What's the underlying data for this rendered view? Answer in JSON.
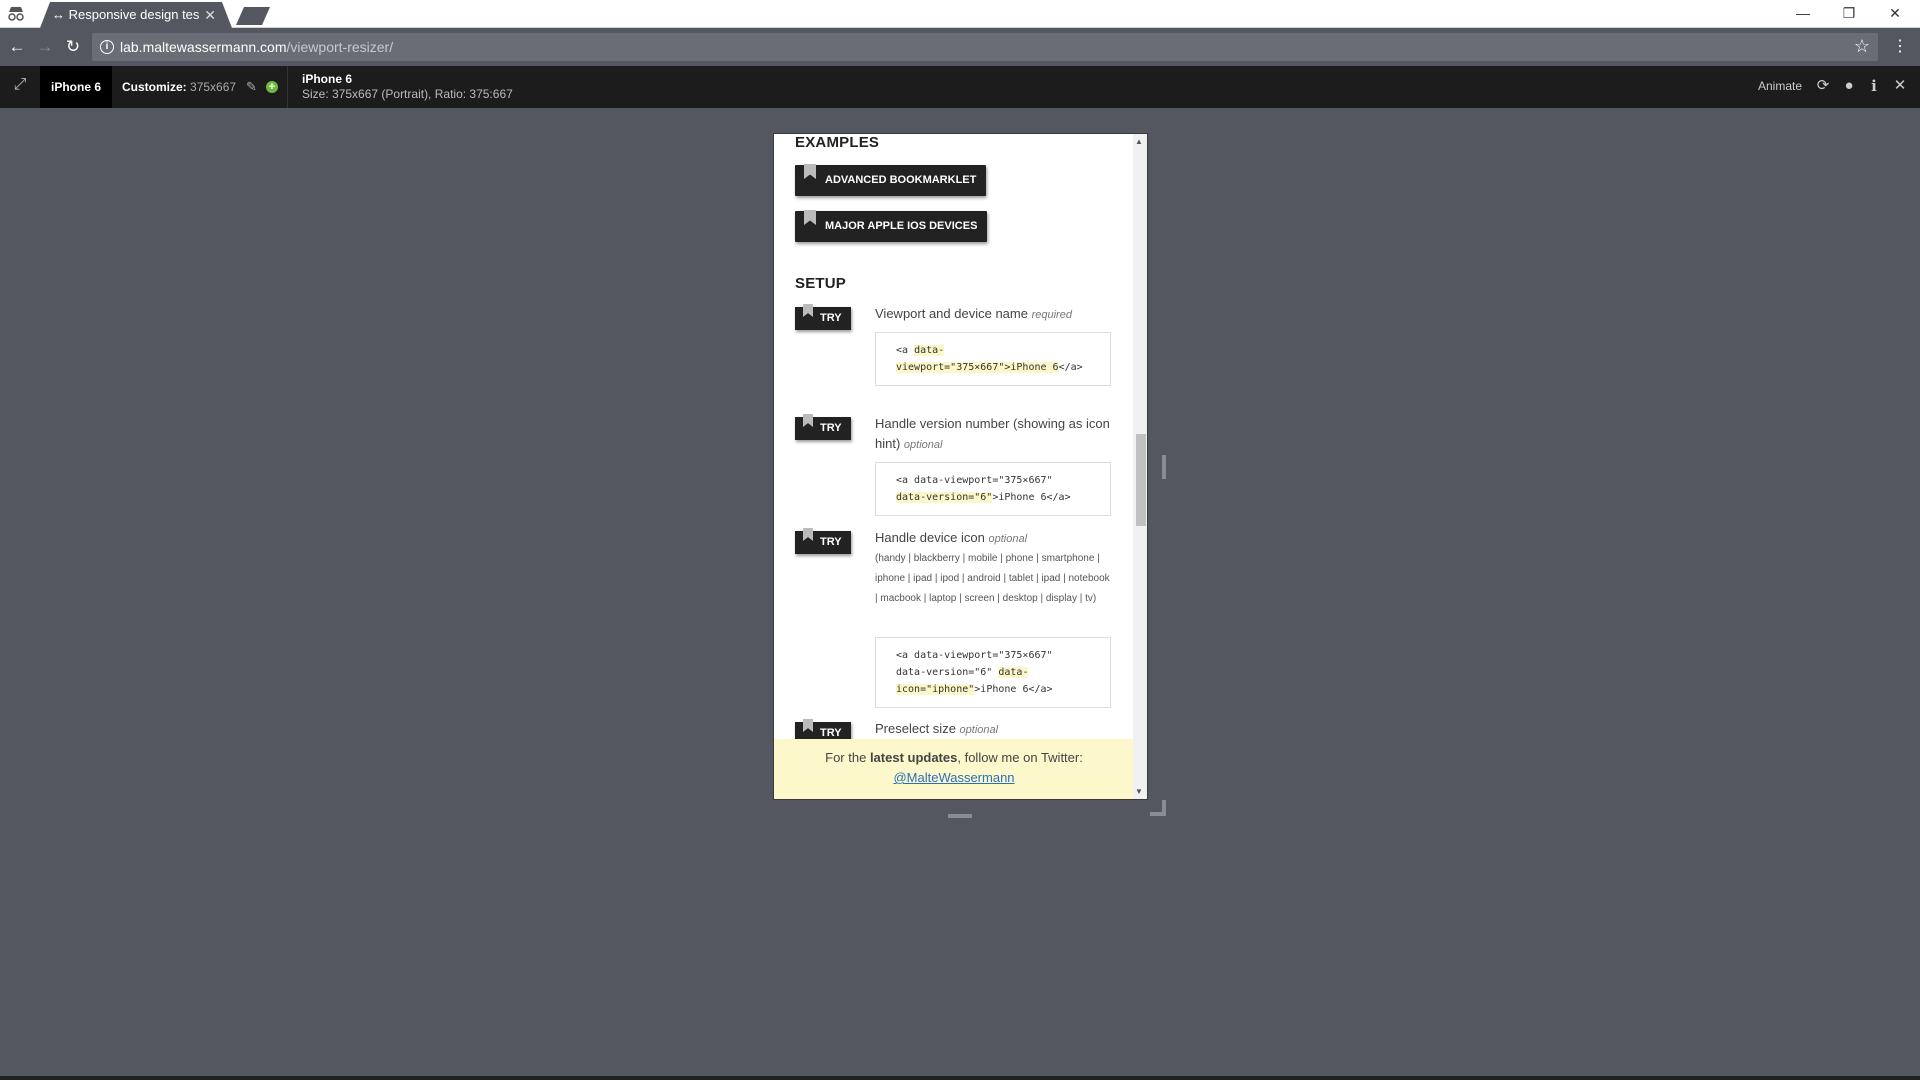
{
  "browser": {
    "tab_title": "↔ Responsive design tes",
    "url_host": "lab.maltewassermann.com",
    "url_path": "/viewport-resizer/"
  },
  "resizer": {
    "device_label": "iPhone 6",
    "customize_label": "Customize:",
    "customize_value": "375x667",
    "info_name": "iPhone 6",
    "info_size": "Size: 375x667 (Portrait), Ratio: 375:667",
    "animate_label": "Animate"
  },
  "page": {
    "examples_heading": "EXAMPLES",
    "example_buttons": [
      "ADVANCED BOOKMARKLET",
      "MAJOR APPLE IOS DEVICES"
    ],
    "setup_heading": "SETUP",
    "try_label": "TRY",
    "rows": [
      {
        "title": "Viewport and device name",
        "note": "required",
        "code_1": "<a ",
        "code_2": "data-viewport=\"375×667\">iPhone 6",
        "code_3": "</a>"
      },
      {
        "title": "Handle version number (showing as icon hint)",
        "note": "optional",
        "code_1": "<a data-viewport=\"375×667\"",
        "code_2": "data-version=\"6\"",
        "code_3": ">iPhone 6</a>"
      },
      {
        "title": "Handle device icon",
        "note": "optional",
        "tags": "(handy | blackberry | mobile | phone | smartphone | iphone | ipad | ipod | android | tablet | ipad | notebook | macbook | laptop | screen | desktop | display | tv)",
        "code_1": "<a data-viewport=\"375×667\"",
        "code_2": "data-version=\"6\" ",
        "code_3": "data-icon=\"iphone\"",
        "code_4": ">iPhone 6</a>"
      },
      {
        "title": "Preselect size",
        "note": "optional"
      }
    ],
    "twitter_text_1": "For the ",
    "twitter_bold": "latest updates",
    "twitter_text_2": ", follow me on Twitter:",
    "twitter_link": "@MalteWassermann"
  }
}
